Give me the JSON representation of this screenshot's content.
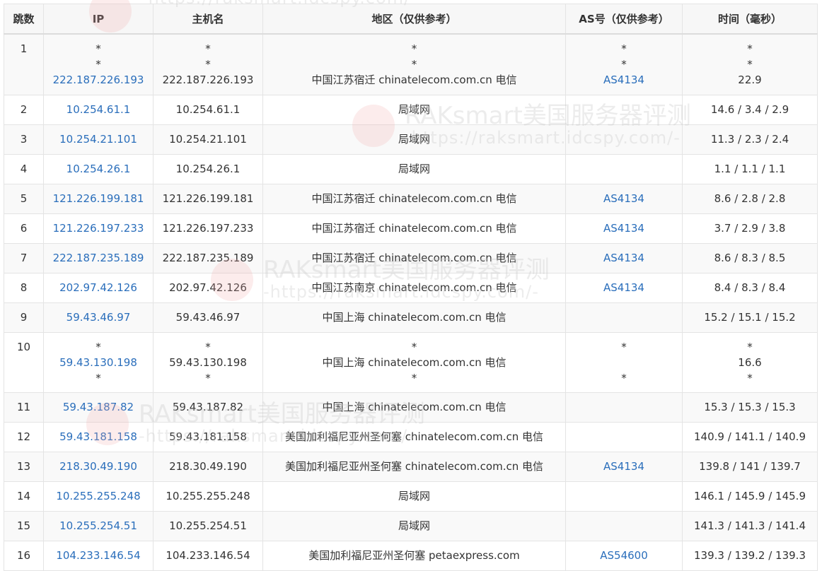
{
  "headers": {
    "hop": "跳数",
    "ip": "IP",
    "host": "主机名",
    "region": "地区（仅供参考）",
    "as": "AS号（仅供参考）",
    "time": "时间（毫秒）"
  },
  "watermark": {
    "title": "RAKsmart美国服务器评测",
    "url": "-https://raksmart.idcspy.com/-"
  },
  "rows": [
    {
      "hop": "1",
      "ip": [
        "*",
        "*",
        "222.187.226.193"
      ],
      "host": [
        "*",
        "*",
        "222.187.226.193"
      ],
      "region": [
        "*",
        "*",
        "中国江苏宿迁 chinatelecom.com.cn 电信"
      ],
      "as": [
        "*",
        "*",
        "AS4134"
      ],
      "time": [
        "*",
        "*",
        "22.9"
      ]
    },
    {
      "hop": "2",
      "ip": [
        "10.254.61.1"
      ],
      "host": [
        "10.254.61.1"
      ],
      "region": [
        "局域网"
      ],
      "as": [
        ""
      ],
      "time": [
        "14.6 / 3.4 / 2.9"
      ]
    },
    {
      "hop": "3",
      "ip": [
        "10.254.21.101"
      ],
      "host": [
        "10.254.21.101"
      ],
      "region": [
        "局域网"
      ],
      "as": [
        ""
      ],
      "time": [
        "11.3 / 2.3 / 2.4"
      ]
    },
    {
      "hop": "4",
      "ip": [
        "10.254.26.1"
      ],
      "host": [
        "10.254.26.1"
      ],
      "region": [
        "局域网"
      ],
      "as": [
        ""
      ],
      "time": [
        "1.1 / 1.1 / 1.1"
      ]
    },
    {
      "hop": "5",
      "ip": [
        "121.226.199.181"
      ],
      "host": [
        "121.226.199.181"
      ],
      "region": [
        "中国江苏宿迁 chinatelecom.com.cn 电信"
      ],
      "as": [
        "AS4134"
      ],
      "time": [
        "8.6 / 2.8 / 2.8"
      ]
    },
    {
      "hop": "6",
      "ip": [
        "121.226.197.233"
      ],
      "host": [
        "121.226.197.233"
      ],
      "region": [
        "中国江苏宿迁 chinatelecom.com.cn 电信"
      ],
      "as": [
        "AS4134"
      ],
      "time": [
        "3.7 / 2.9 / 3.8"
      ]
    },
    {
      "hop": "7",
      "ip": [
        "222.187.235.189"
      ],
      "host": [
        "222.187.235.189"
      ],
      "region": [
        "中国江苏宿迁 chinatelecom.com.cn 电信"
      ],
      "as": [
        "AS4134"
      ],
      "time": [
        "8.6 / 8.3 / 8.5"
      ]
    },
    {
      "hop": "8",
      "ip": [
        "202.97.42.126"
      ],
      "host": [
        "202.97.42.126"
      ],
      "region": [
        "中国江苏南京 chinatelecom.com.cn 电信"
      ],
      "as": [
        "AS4134"
      ],
      "time": [
        "8.4 / 8.3 / 8.4"
      ]
    },
    {
      "hop": "9",
      "ip": [
        "59.43.46.97"
      ],
      "host": [
        "59.43.46.97"
      ],
      "region": [
        "中国上海 chinatelecom.com.cn 电信"
      ],
      "as": [
        ""
      ],
      "time": [
        "15.2 / 15.1 / 15.2"
      ]
    },
    {
      "hop": "10",
      "ip": [
        "*",
        "59.43.130.198",
        "*"
      ],
      "host": [
        "*",
        "59.43.130.198",
        "*"
      ],
      "region": [
        "*",
        "中国上海 chinatelecom.com.cn 电信",
        "*"
      ],
      "as": [
        "*",
        "",
        "*"
      ],
      "time": [
        "*",
        "16.6",
        "*"
      ]
    },
    {
      "hop": "11",
      "ip": [
        "59.43.187.82"
      ],
      "host": [
        "59.43.187.82"
      ],
      "region": [
        "中国上海 chinatelecom.com.cn 电信"
      ],
      "as": [
        ""
      ],
      "time": [
        "15.3 / 15.3 / 15.3"
      ]
    },
    {
      "hop": "12",
      "ip": [
        "59.43.181.158"
      ],
      "host": [
        "59.43.181.158"
      ],
      "region": [
        "美国加利福尼亚州圣何塞 chinatelecom.com.cn 电信"
      ],
      "as": [
        ""
      ],
      "time": [
        "140.9 / 141.1 / 140.9"
      ]
    },
    {
      "hop": "13",
      "ip": [
        "218.30.49.190"
      ],
      "host": [
        "218.30.49.190"
      ],
      "region": [
        "美国加利福尼亚州圣何塞 chinatelecom.com.cn 电信"
      ],
      "as": [
        "AS4134"
      ],
      "time": [
        "139.8 / 141 / 139.7"
      ]
    },
    {
      "hop": "14",
      "ip": [
        "10.255.255.248"
      ],
      "host": [
        "10.255.255.248"
      ],
      "region": [
        "局域网"
      ],
      "as": [
        ""
      ],
      "time": [
        "146.1 / 145.9 / 145.9"
      ]
    },
    {
      "hop": "15",
      "ip": [
        "10.255.254.51"
      ],
      "host": [
        "10.255.254.51"
      ],
      "region": [
        "局域网"
      ],
      "as": [
        ""
      ],
      "time": [
        "141.3 / 141.3 / 141.4"
      ]
    },
    {
      "hop": "16",
      "ip": [
        "104.233.146.54"
      ],
      "host": [
        "104.233.146.54"
      ],
      "region": [
        "美国加利福尼亚州圣何塞 petaexpress.com"
      ],
      "as": [
        "AS54600"
      ],
      "time": [
        "139.3 / 139.2 / 139.3"
      ]
    }
  ]
}
